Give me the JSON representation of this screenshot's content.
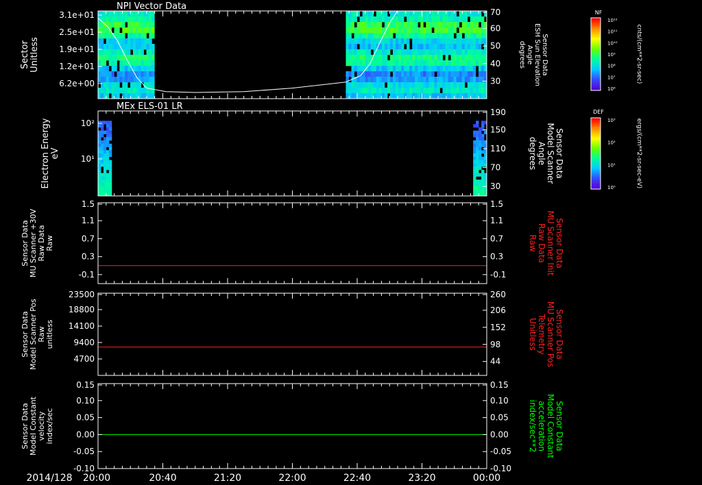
{
  "date_label": "2014/128",
  "time_ticks": [
    "20:00",
    "20:40",
    "21:20",
    "22:00",
    "22:40",
    "23:20",
    "00:00"
  ],
  "colors": {
    "background": "#000000",
    "axis": "#ffffff",
    "red_trace": "#ff2020",
    "green_trace": "#00ff00",
    "red_label": "#ff2020",
    "green_label": "#00ff00"
  },
  "colorbars": [
    {
      "name": "NF",
      "title": "NF",
      "units": "cnts/(cm**2-sr-sec)",
      "tick_labels": [
        "10¹²",
        "10¹¹",
        "10¹⁰",
        "10⁹",
        "10⁸",
        "10⁷",
        "10⁶"
      ]
    },
    {
      "name": "DEF",
      "title": "DEF",
      "units": "ergs/(cm**2-sr-sec-eV)",
      "tick_labels": [
        "10³",
        "10²",
        "10¹",
        "10⁰"
      ]
    }
  ],
  "chart_data": [
    {
      "type": "heatmap",
      "title": "NPI Vector Data",
      "ylabel": "Sector",
      "yunits": "Unitless",
      "yticks": [
        "3.1e+01",
        "2.5e+01",
        "1.9e+01",
        "1.2e+01",
        "6.2e+00"
      ],
      "ylim": [
        0,
        31
      ],
      "y2label": [
        "Sensor Data",
        "ESH Sun Elevation",
        "Angle",
        "degrees"
      ],
      "y2ticks": [
        "70",
        "60",
        "50",
        "40",
        "30"
      ],
      "y2lim": [
        20,
        70
      ],
      "colorbar": "NF",
      "intervals_hours": [
        [
          0,
          0.58
        ],
        [
          2.55,
          4.0
        ]
      ],
      "overlay_line": {
        "color": "#ffffff",
        "x_hours": [
          0,
          0.1,
          0.2,
          0.3,
          0.4,
          0.5,
          0.7,
          1.0,
          1.5,
          2.0,
          2.4,
          2.55,
          2.7,
          2.8,
          2.9,
          3.0,
          3.08
        ],
        "y": [
          66,
          61,
          53,
          42,
          32,
          26,
          24,
          23.5,
          24,
          26,
          28.5,
          29.5,
          33,
          40,
          52,
          63,
          70
        ]
      }
    },
    {
      "type": "heatmap",
      "title": "MEx ELS-01 LR",
      "ylabel": "Electron Energy",
      "yunits": "eV",
      "yscale": "log",
      "yticks": [
        "10²",
        "10¹"
      ],
      "y2label": [
        "Sensor Data",
        "Model Scanner",
        "Angle",
        "degrees"
      ],
      "y2ticks": [
        "190",
        "150",
        "110",
        "70",
        "30"
      ],
      "y2lim": [
        10,
        190
      ],
      "colorbar": "DEF",
      "intervals_hours": [
        [
          0,
          0.14
        ],
        [
          3.86,
          4.0
        ]
      ],
      "overlay_line": {
        "color": "#ffffff",
        "x_hours": [
          0,
          4
        ],
        "y": [
          10,
          10
        ]
      }
    },
    {
      "type": "line",
      "ylabel": [
        "Sensor Data",
        "MU Scanner +30V",
        "Raw Data",
        "Raw"
      ],
      "yticks": [
        "1.5",
        "1.1",
        "0.7",
        "0.3",
        "-0.1"
      ],
      "ylim": [
        -0.3,
        1.5
      ],
      "y2label": [
        "Sensor Data",
        "MU Scanner Init",
        "Raw Data",
        "Raw"
      ],
      "y2ticks": [
        "1.5",
        "1.1",
        "0.7",
        "0.3",
        "-0.1"
      ],
      "y2lim": [
        -0.3,
        1.5
      ],
      "series": [
        {
          "color": "#ff2020",
          "x_hours": [
            0,
            4
          ],
          "y": [
            0.1,
            0.1
          ]
        }
      ]
    },
    {
      "type": "line",
      "ylabel": [
        "Sensor Data",
        "Model Scanner Pos",
        "Raw",
        "unitless"
      ],
      "yticks": [
        "23500",
        "18800",
        "14100",
        "9400",
        "4700"
      ],
      "ylim": [
        0,
        23500
      ],
      "y2label": [
        "Sensor Data",
        "MU Scanner Pos",
        "Telemetry",
        "Unitless"
      ],
      "y2ticks": [
        "260",
        "206",
        "152",
        "98",
        "44"
      ],
      "y2lim": [
        0,
        260
      ],
      "series": [
        {
          "color": "#ff2020",
          "x_hours": [
            0,
            4
          ],
          "y": [
            8100,
            8100
          ]
        }
      ]
    },
    {
      "type": "line",
      "ylabel": [
        "Sensor Data",
        "Model Constant",
        "velocity",
        "index/sec"
      ],
      "yticks": [
        "0.15",
        "0.10",
        "0.05",
        "0.00",
        "-0.05",
        "-0.10"
      ],
      "ylim": [
        -0.1,
        0.15
      ],
      "y2label": [
        "Sensor Data",
        "Model Constant",
        "acceleration",
        "index/sec**2"
      ],
      "y2ticks": [
        "0.15",
        "0.10",
        "0.05",
        "0.00",
        "-0.05",
        "-0.10"
      ],
      "y2lim": [
        -0.1,
        0.15
      ],
      "series": [
        {
          "color": "#00ff00",
          "x_hours": [
            0,
            4
          ],
          "y": [
            0.0,
            0.0
          ]
        }
      ]
    }
  ]
}
